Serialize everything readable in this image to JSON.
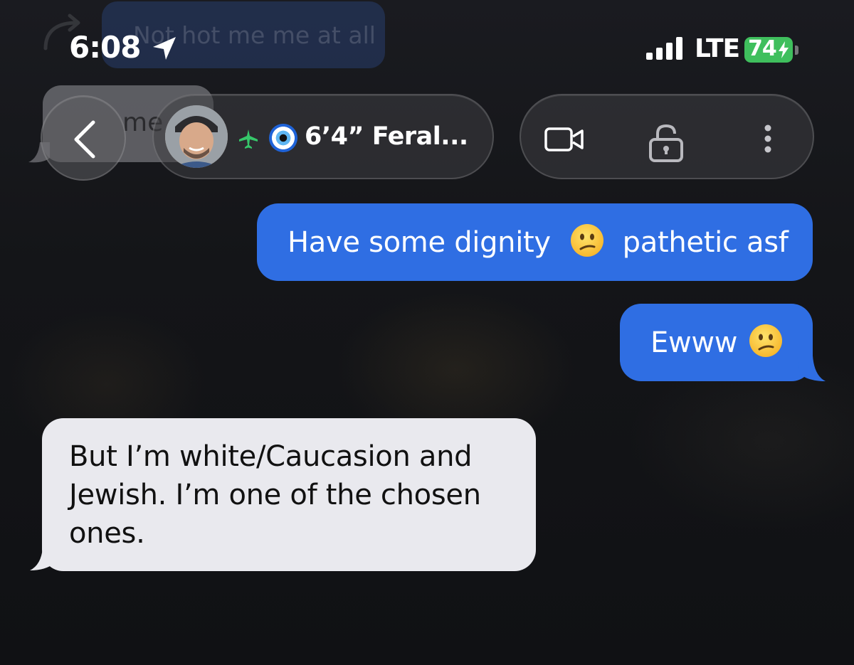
{
  "status_bar": {
    "time": "6:08",
    "carrier": "LTE",
    "battery_level": "74",
    "battery_color": "#3fbf5d",
    "icons": [
      "location-arrow-icon",
      "signal-bars-icon",
      "charging-bolt-icon"
    ]
  },
  "background_text": {
    "faded_message": "Not hot me me at all",
    "faded_gray_message": "me"
  },
  "header": {
    "contact_name": "6’4” Feral...",
    "icons": [
      "back-chevron-icon",
      "airplane-icon",
      "evil-eye-icon",
      "video-camera-icon",
      "lock-icon",
      "more-dots-icon"
    ]
  },
  "messages": [
    {
      "sender": "me",
      "text_before_emoji": "Have some dignity",
      "emoji": "confused-face",
      "text_after_emoji": "pathetic asf"
    },
    {
      "sender": "me",
      "text_before_emoji": "Ewww",
      "emoji": "confused-face"
    },
    {
      "sender": "them",
      "text": "But I’m white/Caucasion and Jewish. I’m one of the chosen ones."
    }
  ],
  "colors": {
    "outgoing_bubble": "#2f6ee3",
    "incoming_bubble": "#e9e9ee",
    "background": "#121316"
  }
}
